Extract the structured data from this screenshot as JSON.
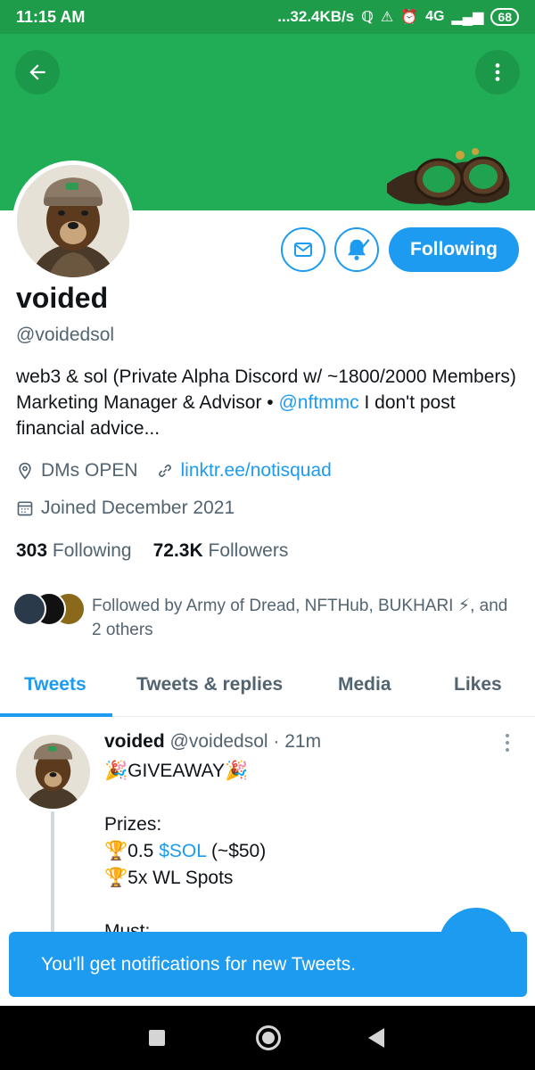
{
  "status_bar": {
    "time": "11:15 AM",
    "network_speed": "...32.4KB/s",
    "signal_label": "4G",
    "battery": "68"
  },
  "colors": {
    "banner": "#20ad55",
    "status_bar": "#1e9c4a",
    "accent": "#1d9bf0",
    "secondary_text": "#536471"
  },
  "profile": {
    "display_name": "voided",
    "handle": "@voidedsol",
    "bio_text": "web3 & sol (Private Alpha Discord w/ ~1800/2000 Members)  Marketing Manager & Advisor • ",
    "bio_mention": "@nftmmc",
    "bio_tail": "  I don't post financial advice...",
    "location": "DMs OPEN",
    "website": "linktr.ee/notisquad",
    "joined": "Joined December 2021",
    "following_count": "303",
    "following_label": "Following",
    "followers_count": "72.3K",
    "followers_label": "Followers",
    "followed_by": "Followed by Army of Dread, NFTHub, BUKHARI ⚡, and 2 others"
  },
  "actions": {
    "following_button": "Following"
  },
  "tabs": [
    "Tweets",
    "Tweets & replies",
    "Media",
    "Likes"
  ],
  "tweet": {
    "author": "voided",
    "handle": "@voidedsol",
    "time": "· 21m",
    "line1_emoji_left": "🎉",
    "line1": "GIVEAWAY",
    "line1_emoji_right": "🎉",
    "prizes_label": "Prizes:",
    "prize1_emoji": "🏆",
    "prize1_a": "0.5 ",
    "prize1_cashtag": "$SOL",
    "prize1_b": " (~$50)",
    "prize2_emoji": "🏆",
    "prize2": "5x WL Spots",
    "must_label": "Must:"
  },
  "toast": {
    "message": "You'll get notifications for new Tweets."
  }
}
